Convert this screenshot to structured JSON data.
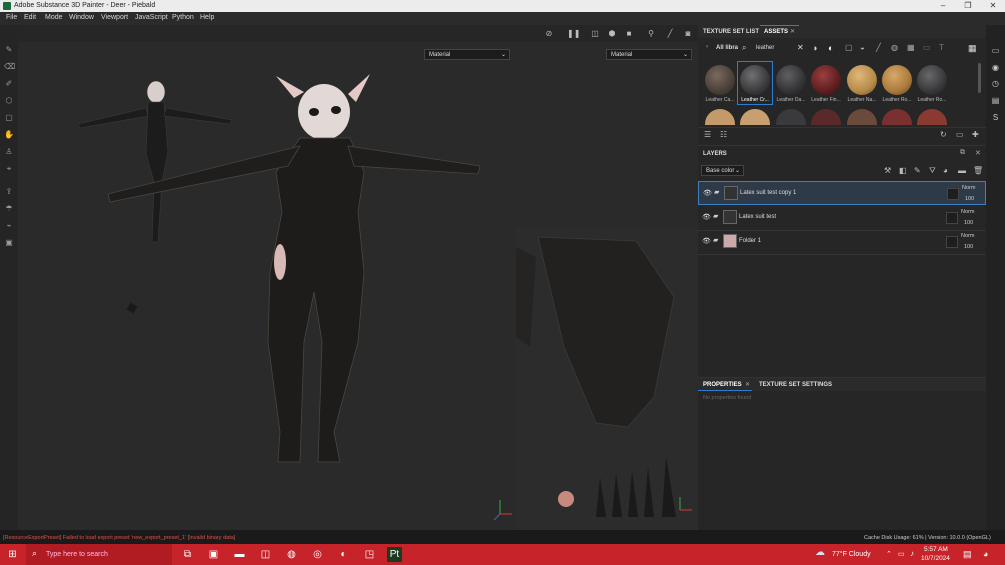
{
  "window": {
    "title": "Adobe Substance 3D Painter - Deer - Piebald",
    "minimize": "–",
    "maximize": "❐",
    "close": "✕"
  },
  "menu": [
    "File",
    "Edit",
    "Mode",
    "Window",
    "Viewport",
    "JavaScript",
    "Python",
    "Help"
  ],
  "viewport": {
    "material_left": "Material",
    "material_right": "Material"
  },
  "assets": {
    "tab_texture_set_list": "TEXTURE SET LIST",
    "tab_assets": "ASSETS",
    "library": "All libra",
    "search_value": "leather",
    "thumbnails": [
      {
        "label": "Leather Ca...",
        "color": "#4a3f38"
      },
      {
        "label": "Leather Cr...",
        "color": "#3a3a3c"
      },
      {
        "label": "Leather Da...",
        "color": "#333335"
      },
      {
        "label": "Leather Fin...",
        "color": "#5e1e1e"
      },
      {
        "label": "Leather Na...",
        "color": "#b58a4a"
      },
      {
        "label": "Leather Ro...",
        "color": "#a87a3c"
      },
      {
        "label": "Leather Ro...",
        "color": "#38383a"
      }
    ],
    "thumbnails_row2": [
      "#c49a6a",
      "#c8a070",
      "#3a3a3c",
      "#5a2a2a",
      "#6a4a3a",
      "#7a3030",
      "#8a3a30"
    ]
  },
  "layers": {
    "header": "LAYERS",
    "channel": "Base color",
    "items": [
      {
        "name": "Latex suit test copy 1",
        "blend": "Norm",
        "opacity": "100"
      },
      {
        "name": "Latex suit test",
        "blend": "Norm",
        "opacity": "100"
      },
      {
        "name": "Folder 1",
        "blend": "Norm",
        "opacity": "100"
      }
    ]
  },
  "properties": {
    "tab_properties": "PROPERTIES",
    "tab_texture_set_settings": "TEXTURE SET SETTINGS",
    "empty": "No properties found"
  },
  "status": {
    "error": "[ResourceExportPreset] Failed to load export preset 'new_export_preset_1' [Invalid binary data]",
    "right": "Cache Disk Usage:   61% | Version: 10.0.0 (OpenGL)"
  },
  "taskbar": {
    "search_placeholder": "Type here to search",
    "weather": "77°F  Cloudy",
    "time": "5:57 AM",
    "date": "10/7/2024"
  }
}
